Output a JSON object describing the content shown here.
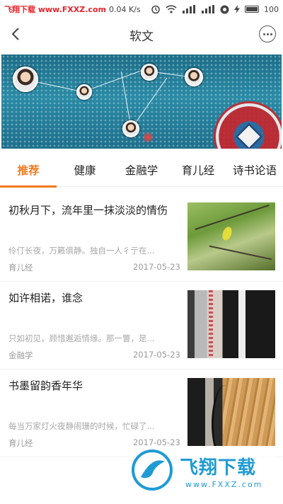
{
  "watermark": {
    "top_left": "飞翔下载 www.FXXZ.com",
    "bottom_logo_text": "飞翔下载",
    "bottom_url": "www.FXXZ.com"
  },
  "status_bar": {
    "network_speed": "0.04 K/s",
    "battery": "100"
  },
  "header": {
    "title": "软文"
  },
  "tabs": [
    {
      "label": "推荐",
      "active": true
    },
    {
      "label": "健康",
      "active": false
    },
    {
      "label": "金融学",
      "active": false
    },
    {
      "label": "育儿经",
      "active": false
    },
    {
      "label": "诗书论语",
      "active": false
    }
  ],
  "articles": [
    {
      "title": "初秋月下，流年里一抹淡淡的情伤",
      "summary": "伶仃长夜，万籁俱静。独自一人彳亍在...",
      "category": "育儿经",
      "date": "2017-05-23"
    },
    {
      "title": "如许相诺，谁念",
      "summary": "只如初见，顾惜邂逅情缘。那一瞥，是...",
      "category": "金融学",
      "date": "2017-05-23"
    },
    {
      "title": "书墨留韵香年华",
      "summary": "每当万家灯火夜静闹珊的时候，忙碌了...",
      "category": "育儿经",
      "date": "2017-05-23"
    }
  ],
  "colors": {
    "accent": "#f07a1e",
    "watermark_red": "#e8232a",
    "watermark_blue": "#1f9bd4"
  }
}
